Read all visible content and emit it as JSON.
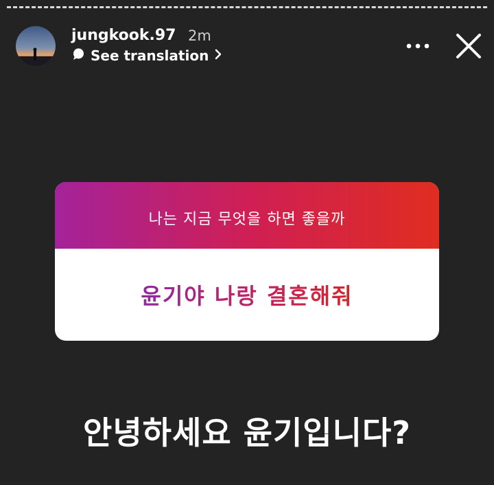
{
  "story": {
    "username": "jungkook.97",
    "time_ago": "2m",
    "translation_label": "See translation",
    "icons": {
      "translate": "speech-bubble-icon",
      "translate_chevron": "chevron-right-icon",
      "more": "more-dots-icon",
      "close": "close-icon"
    }
  },
  "question_sticker": {
    "prompt": "나는 지금 무엇을 하면 좋을까",
    "answer": "윤기야 나랑 결혼해줘",
    "colors": {
      "gradient_start": "#a4239a",
      "gradient_mid": "#cf1f55",
      "gradient_end": "#e02d20"
    }
  },
  "caption": "안녕하세요 윤기입니다?",
  "colors": {
    "background": "#232323",
    "progress_bar": "#d9d9d9"
  }
}
